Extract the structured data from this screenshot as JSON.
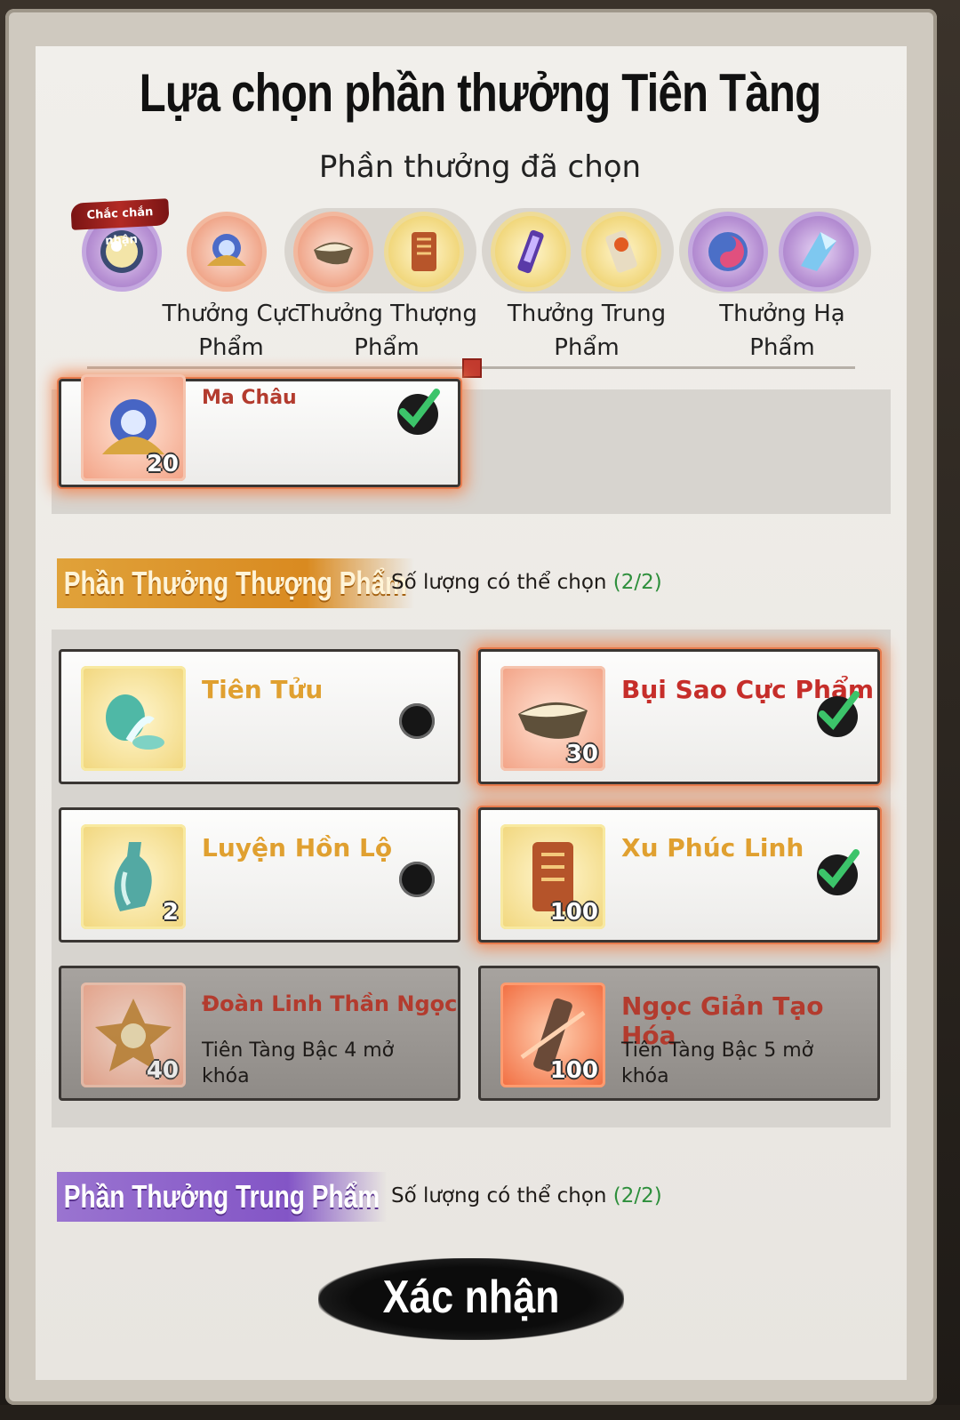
{
  "dialog": {
    "title": "Lựa chọn phần thưởng Tiên Tàng",
    "subtitle": "Phần thưởng đã chọn"
  },
  "tiers": {
    "sure_tag": "Chắc chắn nhận",
    "labels": [
      "Thưởng Cực Phẩm",
      "Thưởng Thượng Phẩm",
      "Thưởng Trung Phẩm",
      "Thưởng Hạ Phẩm"
    ]
  },
  "top_section": {
    "item": {
      "name": "Ma Châu",
      "qty": "20",
      "selected": true
    }
  },
  "thuong_pham": {
    "title": "Phần Thưởng Thượng Phẩm",
    "count_label": "Số lượng có thể chọn",
    "count": "(2/2)",
    "items": [
      {
        "name": "Tiên Tửu",
        "qty": "",
        "selected": false
      },
      {
        "name": "Bụi Sao Cực Phẩm",
        "qty": "30",
        "selected": true
      },
      {
        "name": "Luyện Hồn Lộ",
        "qty": "2",
        "selected": false
      },
      {
        "name": "Xu Phúc Linh",
        "qty": "100",
        "selected": true
      },
      {
        "name": "Đoàn Linh Thần Ngọc",
        "qty": "40",
        "lock": "Tiên Tàng Bậc 4 mở khóa"
      },
      {
        "name": "Ngọc Giản Tạo Hóa",
        "qty": "100",
        "lock": "Tiên Tàng Bậc 5 mở khóa"
      }
    ]
  },
  "trung_pham": {
    "title": "Phần Thưởng Trung Phẩm",
    "count_label": "Số lượng có thể chọn",
    "count": "(2/2)"
  },
  "confirm_label": "Xác nhận",
  "colors": {
    "gold_ribbon": "#d98a20",
    "purple_ribbon": "#8355c6",
    "count_green": "#2e8f3c",
    "selected_glow": "#f08a58"
  }
}
